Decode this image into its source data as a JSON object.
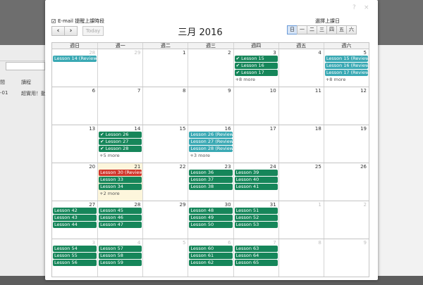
{
  "background": {
    "labels": [
      "間",
      "讀程",
      "-01",
      "超實用！動"
    ]
  },
  "dialog": {
    "help_glyph": "?",
    "close_glyph": "×"
  },
  "toolbar": {
    "email_label": "E-mail 提醒上課時段",
    "email_checked": true,
    "prev_label": "‹",
    "next_label": "›",
    "today_label": "Today",
    "title": "三月 2016",
    "day_select_label": "選擇上課日",
    "day_options": [
      {
        "label": "日",
        "checked": true
      },
      {
        "label": "一",
        "checked": false
      },
      {
        "label": "二",
        "checked": false
      },
      {
        "label": "三",
        "checked": false
      },
      {
        "label": "四",
        "checked": false
      },
      {
        "label": "五",
        "checked": false
      },
      {
        "label": "六",
        "checked": false
      }
    ]
  },
  "calendar": {
    "weekdays": [
      "週日",
      "週一",
      "週二",
      "週三",
      "週四",
      "週五",
      "週六"
    ],
    "colors": {
      "green": "#16865a",
      "teal": "#3aa9b4",
      "red": "#d0352b",
      "today": "#fdf6dc"
    },
    "weeks": [
      [
        {
          "day": "28",
          "other": true,
          "events": [
            {
              "label": "Lesson 14 (Review",
              "color": "teal"
            }
          ]
        },
        {
          "day": "29",
          "other": true,
          "events": []
        },
        {
          "day": "1",
          "events": []
        },
        {
          "day": "2",
          "events": []
        },
        {
          "day": "3",
          "events": [
            {
              "label": "✔ Lesson 15",
              "color": "green"
            },
            {
              "label": "✔ Lesson 16",
              "color": "green"
            },
            {
              "label": "✔ Lesson 17",
              "color": "green"
            }
          ],
          "more": "+8 more"
        },
        {
          "day": "4",
          "events": []
        },
        {
          "day": "5",
          "events": [
            {
              "label": "Lesson 15 (Review",
              "color": "teal"
            },
            {
              "label": "Lesson 16 (Review",
              "color": "teal"
            },
            {
              "label": "Lesson 17 (Review",
              "color": "teal"
            }
          ],
          "more": "+8 more"
        }
      ],
      [
        {
          "day": "6",
          "events": []
        },
        {
          "day": "7",
          "events": []
        },
        {
          "day": "8",
          "events": []
        },
        {
          "day": "9",
          "events": []
        },
        {
          "day": "10",
          "events": []
        },
        {
          "day": "11",
          "events": []
        },
        {
          "day": "12",
          "events": []
        }
      ],
      [
        {
          "day": "13",
          "events": []
        },
        {
          "day": "14",
          "events": [
            {
              "label": "✔ Lesson 26",
              "color": "green"
            },
            {
              "label": "✔ Lesson 27",
              "color": "green"
            },
            {
              "label": "✔ Lesson 28",
              "color": "green"
            }
          ],
          "more": "+5 more"
        },
        {
          "day": "15",
          "events": []
        },
        {
          "day": "16",
          "events": [
            {
              "label": "Lesson 26 (Review",
              "color": "teal"
            },
            {
              "label": "Lesson 27 (Review",
              "color": "teal"
            },
            {
              "label": "Lesson 28 (Review",
              "color": "teal"
            }
          ],
          "more": "+3 more"
        },
        {
          "day": "17",
          "events": []
        },
        {
          "day": "18",
          "events": []
        },
        {
          "day": "19",
          "events": []
        }
      ],
      [
        {
          "day": "20",
          "events": []
        },
        {
          "day": "21",
          "today": true,
          "events": [
            {
              "label": "Lesson 30 (Review",
              "color": "red"
            },
            {
              "label": "Lesson 33",
              "color": "green"
            },
            {
              "label": "Lesson 34",
              "color": "green"
            }
          ],
          "more": "+2 more"
        },
        {
          "day": "22",
          "events": []
        },
        {
          "day": "23",
          "events": [
            {
              "label": "Lesson 36",
              "color": "green"
            },
            {
              "label": "Lesson 37",
              "color": "green"
            },
            {
              "label": "Lesson 38",
              "color": "green"
            }
          ]
        },
        {
          "day": "24",
          "events": [
            {
              "label": "Lesson 39",
              "color": "green"
            },
            {
              "label": "Lesson 40",
              "color": "green"
            },
            {
              "label": "Lesson 41",
              "color": "green"
            }
          ]
        },
        {
          "day": "25",
          "events": []
        },
        {
          "day": "26",
          "events": []
        }
      ],
      [
        {
          "day": "27",
          "events": [
            {
              "label": "Lesson 42",
              "color": "green"
            },
            {
              "label": "Lesson 43",
              "color": "green"
            },
            {
              "label": "Lesson 44",
              "color": "green"
            }
          ]
        },
        {
          "day": "28",
          "events": [
            {
              "label": "Lesson 45",
              "color": "green"
            },
            {
              "label": "Lesson 46",
              "color": "green"
            },
            {
              "label": "Lesson 47",
              "color": "green"
            }
          ]
        },
        {
          "day": "29",
          "events": []
        },
        {
          "day": "30",
          "events": [
            {
              "label": "Lesson 48",
              "color": "green"
            },
            {
              "label": "Lesson 49",
              "color": "green"
            },
            {
              "label": "Lesson 50",
              "color": "green"
            }
          ]
        },
        {
          "day": "31",
          "events": [
            {
              "label": "Lesson 51",
              "color": "green"
            },
            {
              "label": "Lesson 52",
              "color": "green"
            },
            {
              "label": "Lesson 53",
              "color": "green"
            }
          ]
        },
        {
          "day": "1",
          "other": true,
          "events": []
        },
        {
          "day": "2",
          "other": true,
          "events": []
        }
      ],
      [
        {
          "day": "3",
          "other": true,
          "events": [
            {
              "label": "Lesson 54",
              "color": "green"
            },
            {
              "label": "Lesson 55",
              "color": "green"
            },
            {
              "label": "Lesson 56",
              "color": "green"
            }
          ]
        },
        {
          "day": "4",
          "other": true,
          "events": [
            {
              "label": "Lesson 57",
              "color": "green"
            },
            {
              "label": "Lesson 58",
              "color": "green"
            },
            {
              "label": "Lesson 59",
              "color": "green"
            }
          ]
        },
        {
          "day": "5",
          "other": true,
          "events": []
        },
        {
          "day": "6",
          "other": true,
          "events": [
            {
              "label": "Lesson 60",
              "color": "green"
            },
            {
              "label": "Lesson 61",
              "color": "green"
            },
            {
              "label": "Lesson 62",
              "color": "green"
            }
          ]
        },
        {
          "day": "7",
          "other": true,
          "events": [
            {
              "label": "Lesson 63",
              "color": "green"
            },
            {
              "label": "Lesson 64",
              "color": "green"
            },
            {
              "label": "Lesson 65",
              "color": "green"
            }
          ]
        },
        {
          "day": "8",
          "other": true,
          "events": []
        },
        {
          "day": "9",
          "other": true,
          "events": []
        }
      ]
    ]
  }
}
